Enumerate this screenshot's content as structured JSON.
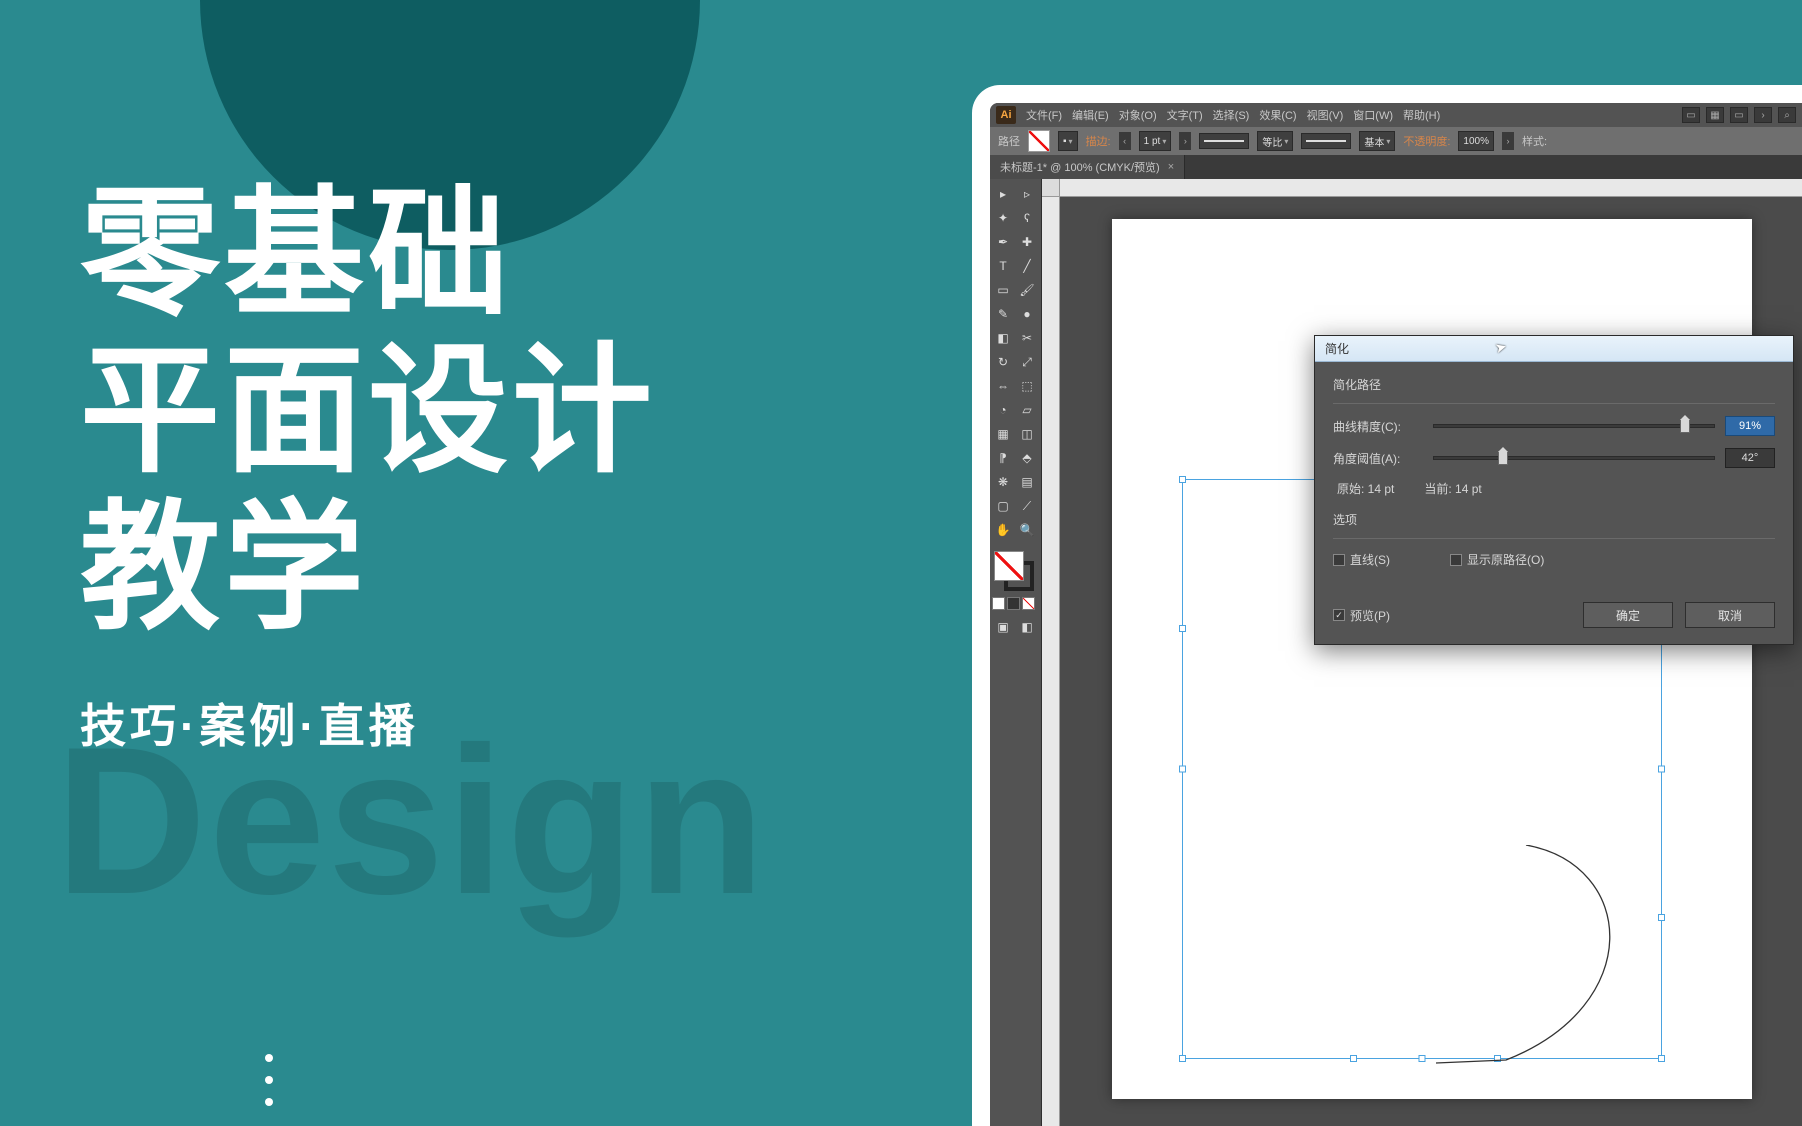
{
  "promo": {
    "line1": "零基础",
    "line2": "平面设计",
    "line3": "教学",
    "sub": "技巧·案例·直播",
    "bgword": "Design"
  },
  "menubar": {
    "logo": "Ai",
    "items": [
      "文件(F)",
      "编辑(E)",
      "对象(O)",
      "文字(T)",
      "选择(S)",
      "效果(C)",
      "视图(V)",
      "窗口(W)",
      "帮助(H)"
    ]
  },
  "controlbar": {
    "left_label": "路径",
    "stroke_label": "描边:",
    "stroke_weight": "1 pt",
    "uniform_label": "等比",
    "profile_label": "基本",
    "opacity_label": "不透明度:",
    "opacity_value": "100%",
    "style_label": "样式:"
  },
  "doc_tab": {
    "title": "未标题-1* @ 100% (CMYK/预览)",
    "close": "×"
  },
  "dialog": {
    "title": "简化",
    "group_path": "简化路径",
    "curve_precision_label": "曲线精度(C):",
    "curve_precision_value": "91%",
    "angle_threshold_label": "角度阈值(A):",
    "angle_threshold_value": "42°",
    "original_label": "原始: 14 pt",
    "current_label": "当前: 14 pt",
    "group_options": "选项",
    "chk_straight": "直线(S)",
    "chk_show_original": "显示原路径(O)",
    "chk_preview": "预览(P)",
    "btn_ok": "确定",
    "btn_cancel": "取消"
  },
  "icons": {
    "search": "⌕",
    "layout": "▭",
    "grid": "▦",
    "more": "›"
  }
}
